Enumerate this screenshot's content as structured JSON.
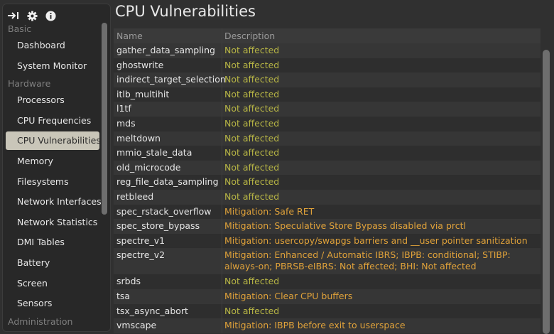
{
  "toolbar": {
    "icons": [
      "collapse-arrow-icon",
      "gear-icon",
      "info-icon"
    ]
  },
  "sidebar": {
    "sections": [
      {
        "title": "Basic",
        "items": [
          "Dashboard",
          "System Monitor"
        ]
      },
      {
        "title": "Hardware",
        "items": [
          "Processors",
          "CPU Frequencies",
          "CPU Vulnerabilities",
          "Memory",
          "Filesystems",
          "Network Interfaces",
          "Network Statistics",
          "DMI Tables",
          "Battery",
          "Screen",
          "Sensors"
        ]
      },
      {
        "title": "Administration",
        "items": []
      }
    ],
    "active_item": "CPU Vulnerabilities"
  },
  "main": {
    "title": "CPU Vulnerabilities",
    "columns": [
      "Name",
      "Description"
    ],
    "rows": [
      {
        "name": "gather_data_sampling",
        "description": "Not affected",
        "status": "ok"
      },
      {
        "name": "ghostwrite",
        "description": "Not affected",
        "status": "ok"
      },
      {
        "name": "indirect_target_selection",
        "description": "Not affected",
        "status": "ok"
      },
      {
        "name": "itlb_multihit",
        "description": "Not affected",
        "status": "ok"
      },
      {
        "name": "l1tf",
        "description": "Not affected",
        "status": "ok"
      },
      {
        "name": "mds",
        "description": "Not affected",
        "status": "ok"
      },
      {
        "name": "meltdown",
        "description": "Not affected",
        "status": "ok"
      },
      {
        "name": "mmio_stale_data",
        "description": "Not affected",
        "status": "ok"
      },
      {
        "name": "old_microcode",
        "description": "Not affected",
        "status": "ok"
      },
      {
        "name": "reg_file_data_sampling",
        "description": "Not affected",
        "status": "ok"
      },
      {
        "name": "retbleed",
        "description": "Not affected",
        "status": "ok"
      },
      {
        "name": "spec_rstack_overflow",
        "description": "Mitigation: Safe RET",
        "status": "mitigation"
      },
      {
        "name": "spec_store_bypass",
        "description": "Mitigation: Speculative Store Bypass disabled via prctl",
        "status": "mitigation"
      },
      {
        "name": "spectre_v1",
        "description": "Mitigation: usercopy/swapgs barriers and __user pointer sanitization",
        "status": "mitigation"
      },
      {
        "name": "spectre_v2",
        "description": "Mitigation: Enhanced / Automatic IBRS; IBPB: conditional; STIBP: always-on; PBRSB-eIBRS: Not affected; BHI: Not affected",
        "status": "mitigation"
      },
      {
        "name": "srbds",
        "description": "Not affected",
        "status": "ok"
      },
      {
        "name": "tsa",
        "description": "Mitigation: Clear CPU buffers",
        "status": "mitigation"
      },
      {
        "name": "tsx_async_abort",
        "description": "Not affected",
        "status": "ok"
      },
      {
        "name": "vmscape",
        "description": "Mitigation: IBPB before exit to userspace",
        "status": "mitigation"
      }
    ]
  },
  "colors": {
    "not_affected": "#b7b545",
    "mitigation": "#e0a23a",
    "active_nav_bg": "#c9c6b9"
  }
}
